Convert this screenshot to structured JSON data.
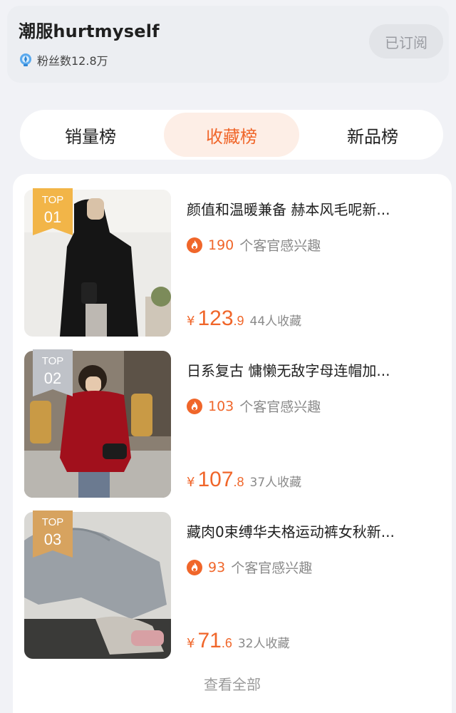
{
  "shop": {
    "name": "潮服hurtmyself",
    "fans_label": "粉丝数12.8万",
    "fans_icon": "fans-badge-icon",
    "subscribe_label": "已订阅"
  },
  "tabs": [
    {
      "label": "销量榜",
      "active": false
    },
    {
      "label": "收藏榜",
      "active": true
    },
    {
      "label": "新品榜",
      "active": false
    }
  ],
  "items": [
    {
      "rank_top": "TOP",
      "rank_num": "01",
      "title": "颜值和温暖兼备 赫本风毛呢新...",
      "interest_count": "190",
      "interest_label": "个客官感兴趣",
      "price_symbol": "¥",
      "price_int": "123",
      "price_dec": ".9",
      "fav_label": "44人收藏"
    },
    {
      "rank_top": "TOP",
      "rank_num": "02",
      "title": "日系复古 慵懒无敌字母连帽加...",
      "interest_count": "103",
      "interest_label": "个客官感兴趣",
      "price_symbol": "¥",
      "price_int": "107",
      "price_dec": ".8",
      "fav_label": "37人收藏"
    },
    {
      "rank_top": "TOP",
      "rank_num": "03",
      "title": "藏肉0束缚华夫格运动裤女秋新...",
      "interest_count": "93",
      "interest_label": "个客官感兴趣",
      "price_symbol": "¥",
      "price_int": "71",
      "price_dec": ".6",
      "fav_label": "32人收藏"
    }
  ],
  "view_all_label": "查看全部",
  "colors": {
    "accent": "#f0662a",
    "rank1": "#f2b548",
    "rank2": "#bfc2c8",
    "rank3": "#d7a35f"
  }
}
